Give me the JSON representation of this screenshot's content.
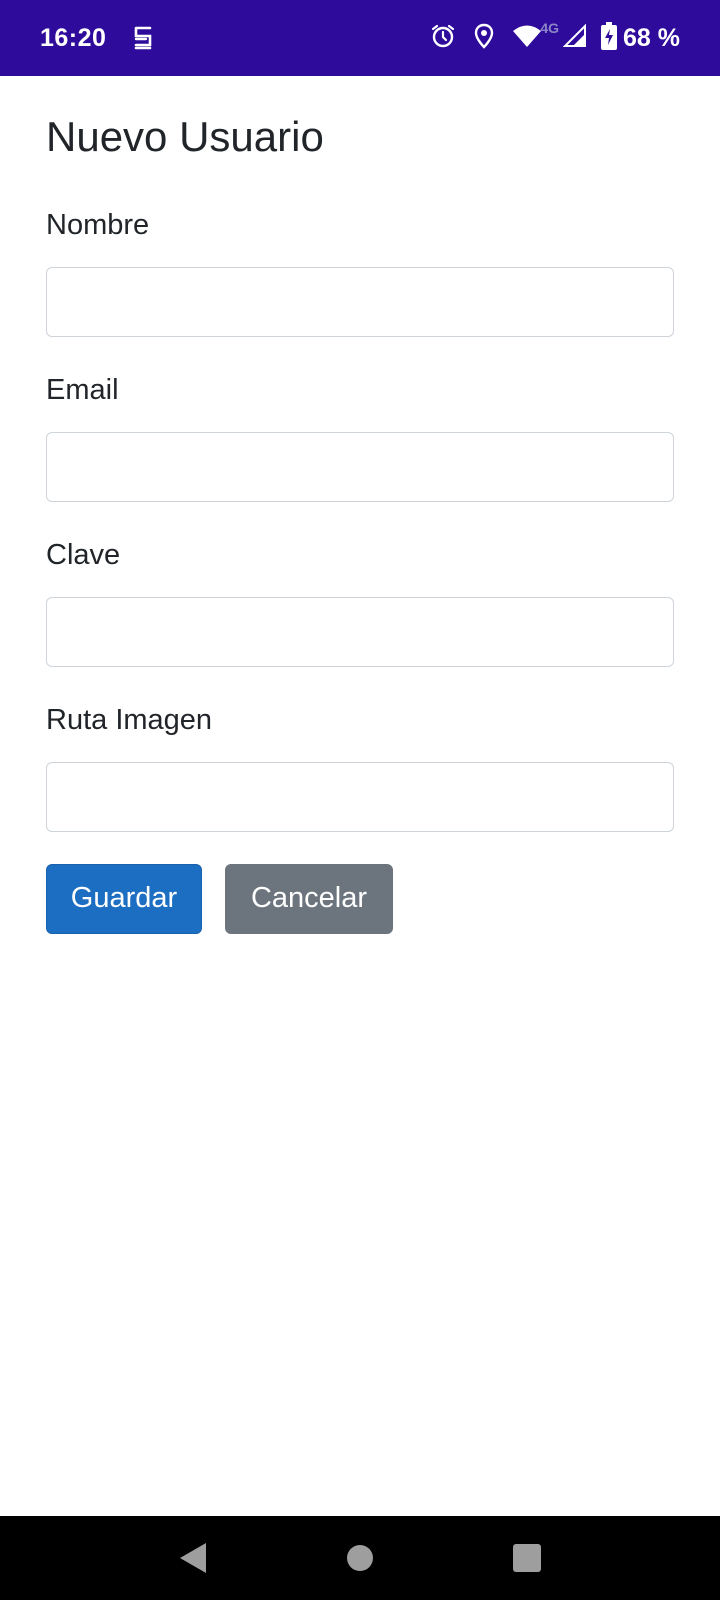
{
  "status_bar": {
    "time": "16:20",
    "app_icon": "s-app-icon",
    "icons": [
      "alarm-icon",
      "location-icon",
      "wifi-icon",
      "cell-signal-icon",
      "battery-charging-icon"
    ],
    "network": "4G",
    "battery": "68 %",
    "background": "#2e0b9a"
  },
  "page": {
    "title": "Nuevo Usuario"
  },
  "form": {
    "fields": [
      {
        "label": "Nombre",
        "value": "",
        "placeholder": ""
      },
      {
        "label": "Email",
        "value": "",
        "placeholder": ""
      },
      {
        "label": "Clave",
        "value": "",
        "placeholder": ""
      },
      {
        "label": "Ruta Imagen",
        "value": "",
        "placeholder": ""
      }
    ]
  },
  "actions": {
    "save_label": "Guardar",
    "cancel_label": "Cancelar",
    "save_color": "#1b6ec2",
    "cancel_color": "#6c757d"
  },
  "nav_bar": {
    "icons": [
      "back-icon",
      "home-icon",
      "recents-icon"
    ]
  }
}
